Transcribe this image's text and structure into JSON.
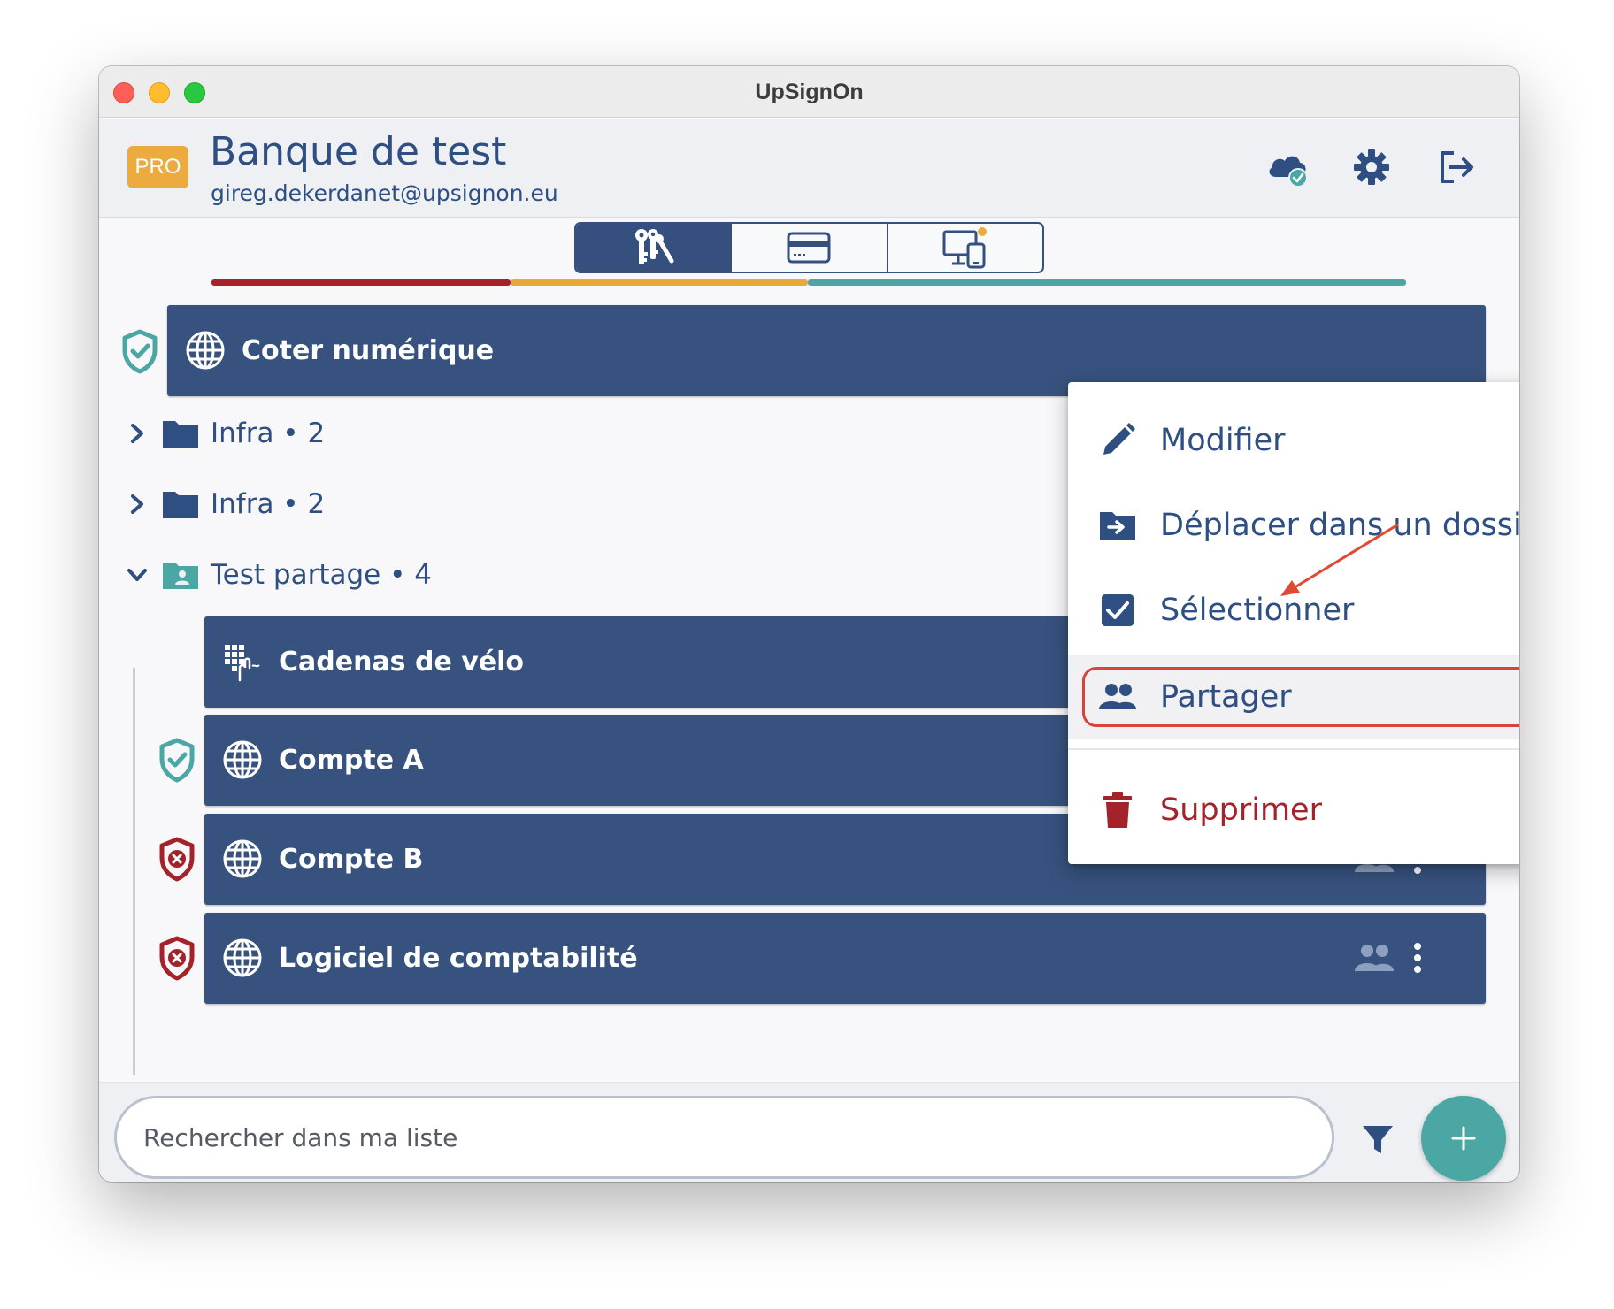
{
  "window": {
    "title": "UpSignOn"
  },
  "header": {
    "badge": "PRO",
    "vault_name": "Banque de test",
    "email": "gireg.dekerdanet@upsignon.eu",
    "icons": [
      "cloud-sync-icon",
      "gear-icon",
      "logout-icon"
    ]
  },
  "tabs": [
    {
      "icon": "keys-icon",
      "active": true
    },
    {
      "icon": "credit-card-icon",
      "active": false
    },
    {
      "icon": "devices-icon",
      "active": false,
      "notification": true
    }
  ],
  "colors": {
    "primary": "#37527e",
    "accent": "#4aa7a3",
    "weak": "#a4232b",
    "medium": "#e8a83c",
    "strong": "#4aa7a3",
    "badge": "#ebab3f"
  },
  "list": {
    "top_item": {
      "label": "Coter numérique",
      "icon": "globe-icon",
      "status": "secure"
    },
    "folders": [
      {
        "label": "Infra • 2",
        "expanded": false
      },
      {
        "label": "Infra • 2",
        "expanded": false
      },
      {
        "label": "Test partage • 4",
        "expanded": true,
        "shared": true
      }
    ],
    "children": [
      {
        "label": "Cadenas de vélo",
        "icon": "keypad-icon",
        "status": "none"
      },
      {
        "label": "Compte A",
        "icon": "globe-icon",
        "status": "secure"
      },
      {
        "label": "Compte B",
        "icon": "globe-icon",
        "status": "weak"
      },
      {
        "label": "Logiciel de comptabilité",
        "icon": "globe-icon",
        "status": "weak"
      }
    ]
  },
  "context_menu": {
    "items": [
      {
        "label": "Modifier",
        "icon": "pencil-icon"
      },
      {
        "label": "Déplacer dans un dossier",
        "icon": "folder-move-icon"
      },
      {
        "label": "Sélectionner",
        "icon": "checkbox-icon"
      },
      {
        "label": "Partager",
        "icon": "people-icon"
      },
      {
        "label": "Supprimer",
        "icon": "trash-icon"
      }
    ]
  },
  "bottom_bar": {
    "search_placeholder": "Rechercher dans ma liste",
    "filter_icon": "filter-icon",
    "add_icon": "plus-icon"
  }
}
